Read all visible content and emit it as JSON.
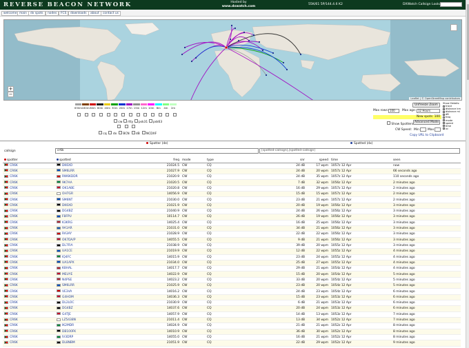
{
  "header": {
    "logo": "REVERSE BEACON NETWORK",
    "hosted_by": "Hosted by",
    "host_site": "www.dxwatch.com",
    "server_info": "55K/61 5P/144.4.6 K2",
    "lookup_label": "DXWatch Callsign Lookup:"
  },
  "nav": [
    "welcome",
    "main",
    "dx spots",
    "nodes",
    "FCS",
    "downloads",
    "about",
    "contact us"
  ],
  "map": {
    "zoom_in": "+",
    "zoom_out": "−",
    "attribution": "Leaflet | © OpenStreetMap contributors"
  },
  "bands": [
    {
      "label": "630m",
      "color": "#a0a0a0"
    },
    {
      "label": "160m",
      "color": "#7f3f00"
    },
    {
      "label": "80m",
      "color": "#d00000"
    },
    {
      "label": "60m",
      "color": "#202020"
    },
    {
      "label": "40m",
      "color": "#e8c800"
    },
    {
      "label": "30m",
      "color": "#00a000"
    },
    {
      "label": "20m",
      "color": "#0030d0"
    },
    {
      "label": "17m",
      "color": "#a000c0"
    },
    {
      "label": "15m",
      "color": "#909090"
    },
    {
      "label": "12m",
      "color": "#ff66cc"
    },
    {
      "label": "10m",
      "color": "#ff00ff"
    },
    {
      "label": "6m",
      "color": "#00ffff"
    },
    {
      "label": "4m",
      "color": "#80ff80"
    },
    {
      "label": "2m",
      "color": "#c0ffc0"
    }
  ],
  "modes_a": [
    "cw",
    "rtty",
    "psk31",
    "psk63"
  ],
  "modes_b": [
    "cq",
    "dx",
    "BCN",
    "dB",
    "NCDXF"
  ],
  "controls": {
    "unfreeze": "Unfreeze Zoom",
    "max_rows_label": "Max rows:",
    "max_rows_value": "100",
    "max_age_label": "Max age:",
    "max_age_value": "12 Hours",
    "new_spots": "New spots: 100",
    "show_spotters": "Show Spotters",
    "advanced": "Advanced Mode",
    "cw_speed": "CW Speed:",
    "min": "Min",
    "max": "Max",
    "copy_url": "Copy URL to Clipboard",
    "show_details_title": "Show Details:",
    "show_details": [
      "trace",
      "distance km",
      "distance mi",
      "dB",
      "freq",
      "mode",
      "speed",
      "time",
      "xc"
    ]
  },
  "filters": {
    "spotter_header": "Spotter (de)",
    "spotted_header": "Spotted (dx)",
    "callsign_label": "callsign",
    "spotter_value": "cr6k",
    "spotted_value": "[spotted-callsign],[spotted-callsign]"
  },
  "table": {
    "headers": [
      "spotter",
      "spotted",
      "freq",
      "mode",
      "type",
      "snr",
      "speed",
      "time",
      "seen"
    ],
    "rows": [
      [
        "CR6K",
        "DK6XO",
        "21024.5",
        "CW",
        "CQ",
        "24 dB",
        "17 wpm",
        "1057z 12 Apr",
        "now"
      ],
      [
        "CR6K",
        "SM6LRR",
        "21027.9",
        "CW",
        "CQ",
        "24 dB",
        "20 wpm",
        "1057z 12 Apr",
        "66 seconds ago"
      ],
      [
        "CR6K",
        "RW6KDDR",
        "21020.9",
        "CW",
        "CQ",
        "24 dB",
        "35 wpm",
        "1057z 12 Apr",
        "110 seconds ago"
      ],
      [
        "CR6K",
        "9K7AA",
        "21020.5",
        "CW",
        "CQ",
        "7 dB",
        "32 wpm",
        "1056z 12 Apr",
        "2 minutes ago"
      ],
      [
        "CR6K",
        "OK1ABE",
        "21020.8",
        "CW",
        "CQ",
        "16 dB",
        "29 wpm",
        "1057z 12 Apr",
        "2 minutes ago"
      ],
      [
        "CR6K",
        "OH7GR",
        "14056.9",
        "CW",
        "CQ",
        "15 dB",
        "15 wpm",
        "1057z 12 Apr",
        "2 minutes ago"
      ],
      [
        "CR6K",
        "SM6NT",
        "21030.0",
        "CW",
        "CQ",
        "23 dB",
        "21 wpm",
        "1057z 12 Apr",
        "2 minutes ago"
      ],
      [
        "CR6K",
        "DK6XO",
        "21021.9",
        "CW",
        "CQ",
        "20 dB",
        "19 wpm",
        "1056z 12 Apr",
        "3 minutes ago"
      ],
      [
        "CR6K",
        "DG4BZ",
        "21040.9",
        "CW",
        "CQ",
        "24 dB",
        "26 wpm",
        "1056z 12 Apr",
        "3 minutes ago"
      ],
      [
        "CR6K",
        "F8FPU",
        "10114.7",
        "CW",
        "CQ",
        "26 dB",
        "19 wpm",
        "1056z 12 Apr",
        "3 minutes ago"
      ],
      [
        "CR6K",
        "K3KRG",
        "14025.4",
        "CW",
        "CQ",
        "16 dB",
        "25 wpm",
        "1056z 12 Apr",
        "3 minutes ago"
      ],
      [
        "CR6K",
        "9A1AR",
        "21031.0",
        "CW",
        "CQ",
        "34 dB",
        "21 wpm",
        "1056z 12 Apr",
        "3 minutes ago"
      ],
      [
        "CR6K",
        "RA3AY",
        "21028.9",
        "CW",
        "CQ",
        "22 dB",
        "22 wpm",
        "1056z 12 Apr",
        "3 minutes ago"
      ],
      [
        "CR6K",
        "OK7DA/P",
        "14055.5",
        "CW",
        "CQ",
        "9 dB",
        "21 wpm",
        "1056z 12 Apr",
        "3 minutes ago"
      ],
      [
        "CR6K",
        "DL7FIA",
        "21038.9",
        "CW",
        "CQ",
        "39 dB",
        "20 wpm",
        "1055z 12 Apr",
        "3 minutes ago"
      ],
      [
        "CR6K",
        "UA1CE",
        "21019.9",
        "CW",
        "CQ",
        "12 dB",
        "22 wpm",
        "1055z 12 Apr",
        "4 minutes ago"
      ],
      [
        "CR6K",
        "IQ4FC",
        "14015.9",
        "CW",
        "CQ",
        "23 dB",
        "24 wpm",
        "1055z 12 Apr",
        "4 minutes ago"
      ],
      [
        "CR6K",
        "UA1APX",
        "21034.0",
        "CW",
        "CQ",
        "25 dB",
        "27 wpm",
        "1055z 12 Apr",
        "4 minutes ago"
      ],
      [
        "CR6K",
        "K8HAL",
        "14017.7",
        "CW",
        "CQ",
        "29 dB",
        "21 wpm",
        "1054z 12 Apr",
        "4 minutes ago"
      ],
      [
        "CR6K",
        "MEUYE",
        "14022.9",
        "CW",
        "CQ",
        "15 dB",
        "20 wpm",
        "1054z 12 Apr",
        "5 minutes ago"
      ],
      [
        "CR6K",
        "N4PSE",
        "14023.2",
        "CW",
        "CQ",
        "33 dB",
        "20 wpm",
        "1054z 12 Apr",
        "5 minutes ago"
      ],
      [
        "CR6K",
        "SM6LRR",
        "21025.9",
        "CW",
        "CQ",
        "23 dB",
        "20 wpm",
        "1054z 12 Apr",
        "5 minutes ago"
      ],
      [
        "CR6K",
        "VE3VA",
        "14016.2",
        "CW",
        "CQ",
        "24 dB",
        "23 wpm",
        "1054z 12 Apr",
        "6 minutes ago"
      ],
      [
        "CR6K",
        "G4HOM",
        "14036.3",
        "CW",
        "CQ",
        "15 dB",
        "23 wpm",
        "1053z 12 Apr",
        "6 minutes ago"
      ],
      [
        "CR6K",
        "DL2LOC",
        "21030.9",
        "CW",
        "CQ",
        "6 dB",
        "21 wpm",
        "1053z 12 Apr",
        "6 minutes ago"
      ],
      [
        "CR6K",
        "DG4BZ",
        "14037.6",
        "CW",
        "CQ",
        "20 dB",
        "24 wpm",
        "1053z 12 Apr",
        "6 minutes ago"
      ],
      [
        "CR6K",
        "G4TJE",
        "14057.9",
        "CW",
        "CQ",
        "14 dB",
        "13 wpm",
        "1053z 12 Apr",
        "7 minutes ago"
      ],
      [
        "CR6K",
        "LZ5438N",
        "21011.4",
        "CW",
        "CQ",
        "13 dB",
        "34 wpm",
        "1052z 12 Apr",
        "7 minutes ago"
      ],
      [
        "CR6K",
        "IK2MDR",
        "14024.9",
        "CW",
        "CQ",
        "21 dB",
        "21 wpm",
        "1052z 12 Apr",
        "8 minutes ago"
      ],
      [
        "CR6K",
        "DB100FK",
        "14010.9",
        "CW",
        "CQ",
        "36 dB",
        "30 wpm",
        "1052z 12 Apr",
        "8 minutes ago"
      ],
      [
        "CR6K",
        "IV3DRP",
        "14055.0",
        "CW",
        "CQ",
        "16 dB",
        "21 wpm",
        "1052z 12 Apr",
        "8 minutes ago"
      ],
      [
        "CR6K",
        "DL8NBM",
        "21051.9",
        "CW",
        "CQ",
        "22 dB",
        "29 wpm",
        "1052z 12 Apr",
        "9 minutes ago"
      ]
    ],
    "spotted_flags": [
      "#000000",
      "#0050c0",
      "#d00000",
      "#008a3a",
      "#c8102e",
      "#ffffff",
      "#0050c0",
      "#000000",
      "#000000",
      "#0050c0",
      "#b22234",
      "#1a5fb4",
      "#d00000",
      "#c8102e",
      "#000000",
      "#0050c0",
      "#008a3a",
      "#0050c0",
      "#b22234",
      "#c8102e",
      "#b22234",
      "#0050c0",
      "#d00000",
      "#c8102e",
      "#000000",
      "#000000",
      "#c8102e",
      "#ffffff",
      "#008a3a",
      "#000000",
      "#008a3a",
      "#000000"
    ]
  }
}
